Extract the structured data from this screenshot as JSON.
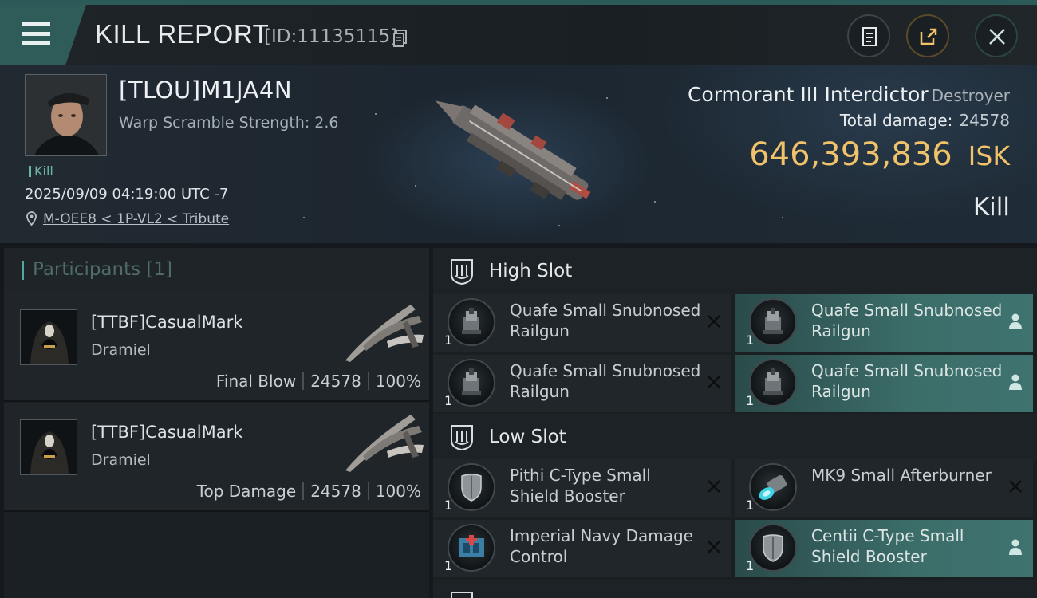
{
  "header": {
    "title": "KILL REPORT",
    "report_id": "[ID:11135115]"
  },
  "victim": {
    "name": "[TLOU]M1JA4N",
    "stat": "Warp Scramble Strength: 2.6",
    "tag": "Kill",
    "datetime": "2025/09/09 04:19:00 UTC -7",
    "location": "M-OEE8 < 1P-VL2 < Tribute"
  },
  "ship": {
    "name": "Cormorant III Interdictor",
    "class": "Destroyer",
    "total_damage_label": "Total damage:",
    "total_damage": "24578",
    "isk_value": "646,393,836",
    "isk_unit": "ISK",
    "result": "Kill"
  },
  "participants": {
    "title": "Participants [1]",
    "cards": [
      {
        "name": "[TTBF]CasualMark",
        "ship": "Dramiel",
        "role": "Final Blow",
        "damage": "24578",
        "percent": "100%"
      },
      {
        "name": "[TTBF]CasualMark",
        "ship": "Dramiel",
        "role": "Top Damage",
        "damage": "24578",
        "percent": "100%"
      }
    ]
  },
  "slots": {
    "high": {
      "title": "High Slot",
      "modules": [
        {
          "name": "Quafe Small Snubnosed Railgun",
          "qty": "1",
          "icon": "railgun-icon",
          "state": "destroyed"
        },
        {
          "name": "Quafe Small Snubnosed Railgun",
          "qty": "1",
          "icon": "railgun-icon",
          "state": "dropped"
        },
        {
          "name": "Quafe Small Snubnosed Railgun",
          "qty": "1",
          "icon": "railgun-icon",
          "state": "destroyed"
        },
        {
          "name": "Quafe Small Snubnosed Railgun",
          "qty": "1",
          "icon": "railgun-icon",
          "state": "dropped"
        }
      ]
    },
    "low": {
      "title": "Low Slot",
      "modules": [
        {
          "name": "Pithi C-Type Small Shield Booster",
          "qty": "1",
          "icon": "shield-booster-icon",
          "state": "destroyed"
        },
        {
          "name": "MK9 Small Afterburner",
          "qty": "1",
          "icon": "afterburner-icon",
          "state": "destroyed"
        },
        {
          "name": "Imperial Navy Damage Control",
          "qty": "1",
          "icon": "damage-control-icon",
          "state": "destroyed"
        },
        {
          "name": "Centii C-Type Small Shield Booster",
          "qty": "1",
          "icon": "shield-booster-icon",
          "state": "dropped"
        }
      ]
    }
  },
  "colors": {
    "accent": "#2f5c59",
    "isk": "#f0c26a",
    "dropped_bg": "#3c6d69"
  }
}
